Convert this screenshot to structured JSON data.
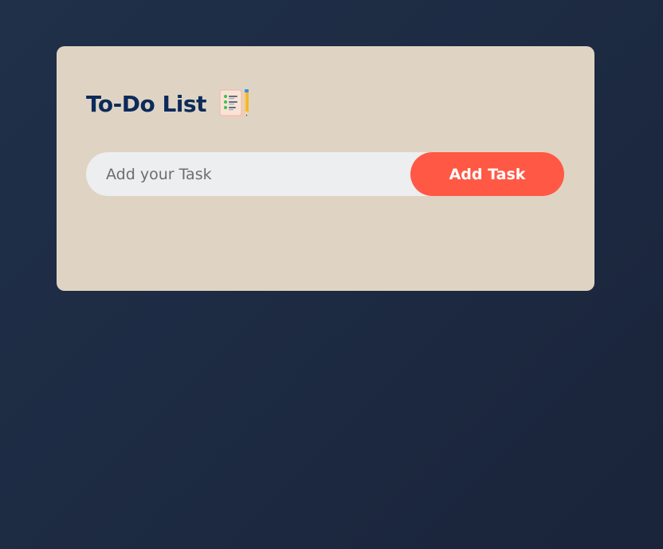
{
  "app": {
    "title": "To-Do List",
    "title_icon": "notepad-checklist-icon"
  },
  "task_form": {
    "input_value": "",
    "input_placeholder": "Add your Task",
    "add_button_label": "Add Task"
  },
  "tasks": [],
  "colors": {
    "background": "#1d2b43",
    "card": "#dfd4c3",
    "title": "#0c2a5b",
    "input_bg": "#edeef0",
    "button": "#ff5945",
    "button_text": "#ffffff"
  }
}
